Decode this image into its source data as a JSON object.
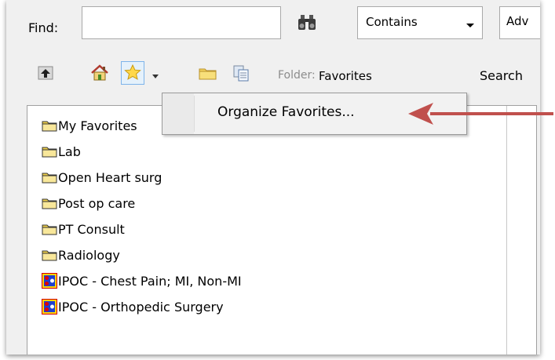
{
  "toolbar": {
    "find_label": "Find:",
    "find_value": "",
    "match_select": "Contains",
    "advanced_partial": "Adv",
    "folder_label": "Folder:",
    "folder_value": "Favorites",
    "search_partial": "Search"
  },
  "dropdown_menu": {
    "items": [
      {
        "label": "Organize Favorites..."
      }
    ]
  },
  "favorites_list": {
    "items": [
      {
        "label": "My Favorites",
        "icon": "folder-icon"
      },
      {
        "label": "Lab",
        "icon": "folder-icon"
      },
      {
        "label": "Open Heart surg",
        "icon": "folder-icon"
      },
      {
        "label": "Post op care",
        "icon": "folder-icon"
      },
      {
        "label": "PT Consult",
        "icon": "folder-icon"
      },
      {
        "label": "Radiology",
        "icon": "folder-icon"
      },
      {
        "label": "IPOC - Chest Pain; MI, Non-MI",
        "icon": "ipoc-plan-icon"
      },
      {
        "label": "IPOC - Orthopedic Surgery",
        "icon": "ipoc-plan-icon"
      }
    ]
  },
  "annotation": {
    "arrow_color": "#c0504d"
  }
}
